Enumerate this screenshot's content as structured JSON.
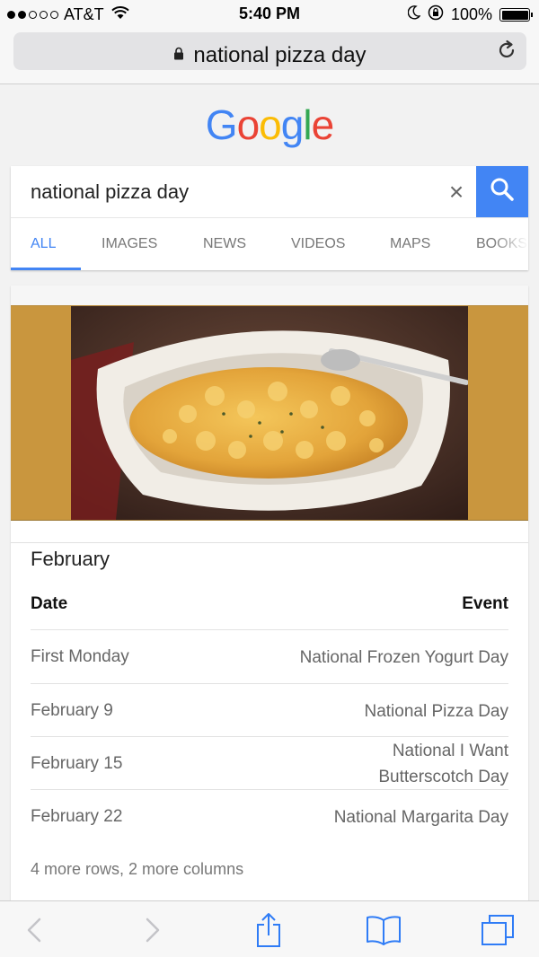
{
  "status_bar": {
    "carrier": "AT&T",
    "signal_bars_filled": 2,
    "signal_bars_total": 5,
    "time": "5:40 PM",
    "battery_percent": "100%",
    "icons": [
      "wifi-icon",
      "moon-icon",
      "rotation-lock-icon",
      "battery-icon"
    ]
  },
  "browser": {
    "url_text": "national pizza day",
    "icons": [
      "lock-icon",
      "reload-icon"
    ]
  },
  "google": {
    "logo_letters": [
      {
        "char": "G",
        "color": "#4285f4"
      },
      {
        "char": "o",
        "color": "#ea4335"
      },
      {
        "char": "o",
        "color": "#fbbc05"
      },
      {
        "char": "g",
        "color": "#4285f4"
      },
      {
        "char": "l",
        "color": "#34a853"
      },
      {
        "char": "e",
        "color": "#ea4335"
      }
    ]
  },
  "search": {
    "query": "national pizza day",
    "clear_label": "×",
    "accent_color": "#4285f4",
    "tabs": [
      {
        "label": "ALL",
        "active": true
      },
      {
        "label": "IMAGES",
        "active": false
      },
      {
        "label": "NEWS",
        "active": false
      },
      {
        "label": "VIDEOS",
        "active": false
      },
      {
        "label": "MAPS",
        "active": false
      },
      {
        "label": "BOOKS",
        "active": false
      }
    ]
  },
  "result": {
    "title": "February",
    "columns": {
      "date": "Date",
      "event": "Event"
    },
    "rows": [
      {
        "date": "First Monday",
        "event": "National Frozen Yogurt Day"
      },
      {
        "date": "February 9",
        "event": "National Pizza Day"
      },
      {
        "date": "February 15",
        "event": "National I Want Butterscotch Day"
      },
      {
        "date": "February 22",
        "event": "National Margarita Day"
      }
    ],
    "more": "4 more rows, 2 more columns"
  },
  "toolbar": {
    "icons": [
      "back-icon",
      "forward-icon",
      "share-icon",
      "bookmarks-icon",
      "tabs-icon"
    ]
  }
}
